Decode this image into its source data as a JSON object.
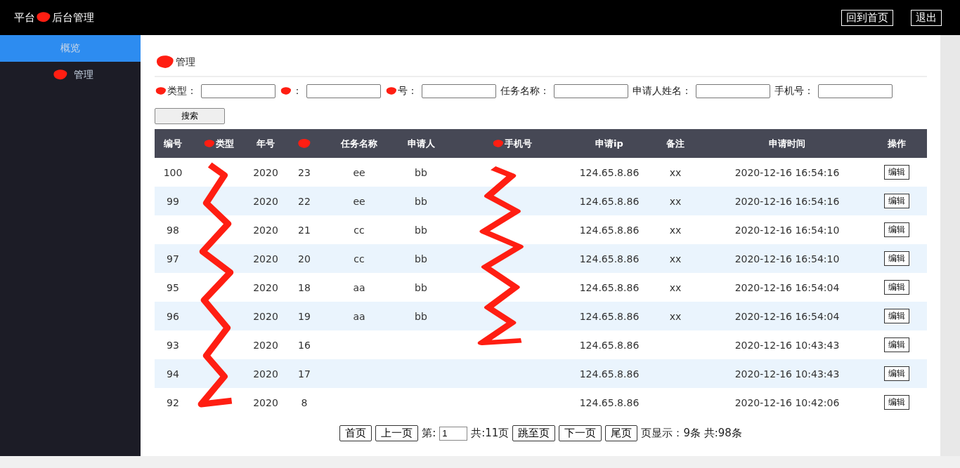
{
  "header": {
    "title_start": "平台",
    "title_end": "后台管理",
    "buttons": [
      "回到首页",
      "退出"
    ]
  },
  "sidebar": {
    "items": [
      {
        "label": "概览",
        "selected": true,
        "redacted": false
      },
      {
        "label": "管理",
        "selected": false,
        "redacted": true
      }
    ]
  },
  "page_title": "管理",
  "filters": [
    {
      "label": "类型：",
      "redacted": true
    },
    {
      "label": "：",
      "redacted": true
    },
    {
      "label": "号：",
      "redacted": true
    },
    {
      "label": "任务名称：",
      "redacted": false
    },
    {
      "label": "申请人姓名：",
      "redacted": false
    },
    {
      "label": "手机号：",
      "redacted": false
    }
  ],
  "search_button": "搜索",
  "table": {
    "columns": [
      {
        "label": "编号",
        "redacted": false
      },
      {
        "label": "类型",
        "redacted": true
      },
      {
        "label": "年号",
        "redacted": false
      },
      {
        "redacted": true
      },
      {
        "label": "任务名称",
        "redacted": false
      },
      {
        "label": "申请人",
        "redacted": false
      },
      {
        "label": "手机号",
        "redacted": true
      },
      {
        "label": "申请ip",
        "redacted": false
      },
      {
        "label": "备注",
        "redacted": false
      },
      {
        "label": "申请时间",
        "redacted": false
      },
      {
        "label": "操作",
        "redacted": false
      }
    ],
    "rows": [
      [
        "100",
        "",
        "2020",
        "23",
        "ee",
        "bb",
        "",
        "124.65.8.86",
        "xx",
        "2020-12-16 16:54:16",
        "编辑"
      ],
      [
        "99",
        "",
        "2020",
        "22",
        "ee",
        "bb",
        "",
        "124.65.8.86",
        "xx",
        "2020-12-16 16:54:16",
        "编辑"
      ],
      [
        "98",
        "",
        "2020",
        "21",
        "cc",
        "bb",
        "",
        "124.65.8.86",
        "xx",
        "2020-12-16 16:54:10",
        "编辑"
      ],
      [
        "97",
        "",
        "2020",
        "20",
        "cc",
        "bb",
        "",
        "124.65.8.86",
        "xx",
        "2020-12-16 16:54:10",
        "编辑"
      ],
      [
        "95",
        "",
        "2020",
        "18",
        "aa",
        "bb",
        "",
        "124.65.8.86",
        "xx",
        "2020-12-16 16:54:04",
        "编辑"
      ],
      [
        "96",
        "",
        "2020",
        "19",
        "aa",
        "bb",
        "",
        "124.65.8.86",
        "xx",
        "2020-12-16 16:54:04",
        "编辑"
      ],
      [
        "93",
        "",
        "2020",
        "16",
        "",
        "",
        "",
        "124.65.8.86",
        "",
        "2020-12-16 10:43:43",
        "编辑"
      ],
      [
        "94",
        "",
        "2020",
        "17",
        "",
        "",
        "",
        "124.65.8.86",
        "",
        "2020-12-16 10:43:43",
        "编辑"
      ],
      [
        "92",
        "",
        "2020",
        "8",
        "",
        "",
        "",
        "124.65.8.86",
        "",
        "2020-12-16 10:42:06",
        "编辑"
      ]
    ]
  },
  "pagination": {
    "first": "首页",
    "prev": "上一页",
    "page_label": "第:",
    "page_value": "1",
    "total_pages": "共:11页",
    "jump": "跳至页",
    "next": "下一页",
    "last": "尾页",
    "summary": "页显示：9条 共:98条"
  }
}
